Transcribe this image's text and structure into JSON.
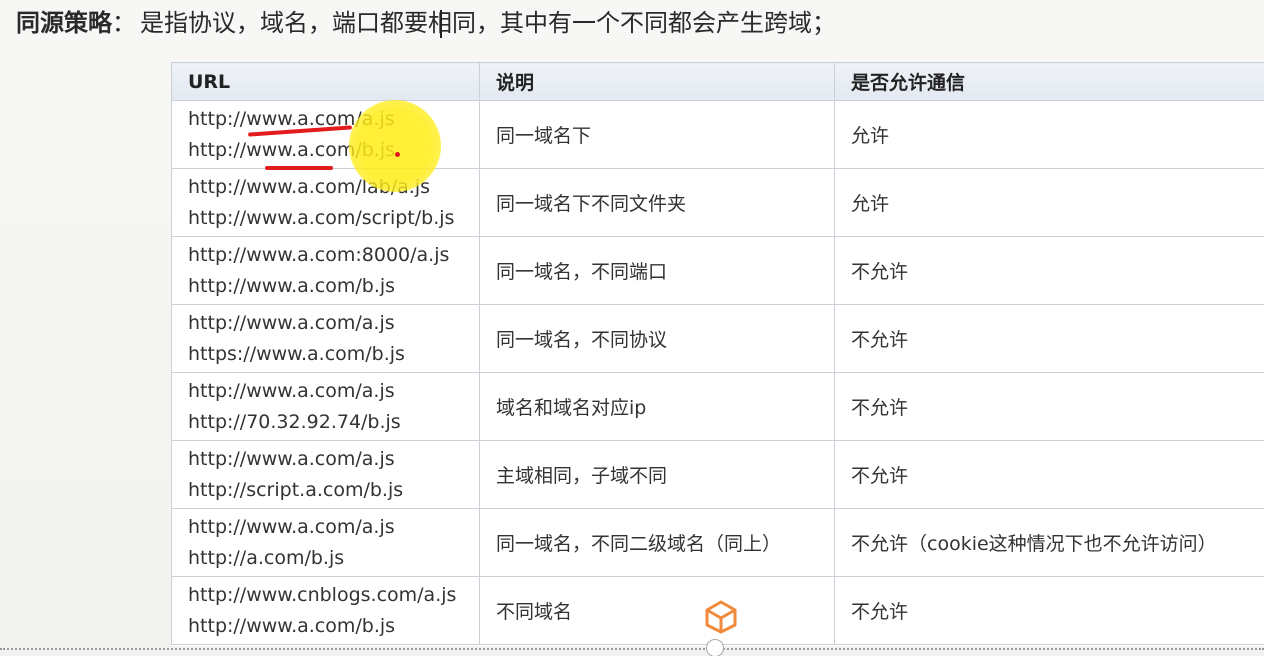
{
  "heading": {
    "term": "同源策略",
    "colon": "：",
    "text": "是指协议，域名，端口都要相同，其中有一个不同都会产生跨域；"
  },
  "table": {
    "headers": [
      "URL",
      "说明",
      "是否允许通信"
    ],
    "rows": [
      {
        "urls": [
          "http://www.a.com/a.js",
          "http://www.a.com/b.js"
        ],
        "desc": "同一域名下",
        "allow": "允许"
      },
      {
        "urls": [
          "http://www.a.com/lab/a.js",
          "http://www.a.com/script/b.js"
        ],
        "desc": "同一域名下不同文件夹",
        "allow": "允许"
      },
      {
        "urls": [
          "http://www.a.com:8000/a.js",
          "http://www.a.com/b.js"
        ],
        "desc": "同一域名，不同端口",
        "allow": "不允许"
      },
      {
        "urls": [
          "http://www.a.com/a.js",
          "https://www.a.com/b.js"
        ],
        "desc": "同一域名，不同协议",
        "allow": "不允许"
      },
      {
        "urls": [
          "http://www.a.com/a.js",
          "http://70.32.92.74/b.js"
        ],
        "desc": "域名和域名对应ip",
        "allow": "不允许"
      },
      {
        "urls": [
          "http://www.a.com/a.js",
          "http://script.a.com/b.js"
        ],
        "desc": "主域相同，子域不同",
        "allow": "不允许"
      },
      {
        "urls": [
          "http://www.a.com/a.js",
          "http://a.com/b.js"
        ],
        "desc": "同一域名，不同二级域名（同上）",
        "allow": "不允许（cookie这种情况下也不允许访问）"
      },
      {
        "urls": [
          "http://www.cnblogs.com/a.js",
          "http://www.a.com/b.js"
        ],
        "desc": "不同域名",
        "allow": "不允许"
      }
    ]
  },
  "annotations": {
    "highlight_color": "#ffec14",
    "pen_color": "#e21c1c"
  },
  "watermark_icon": "cube-logo-icon"
}
